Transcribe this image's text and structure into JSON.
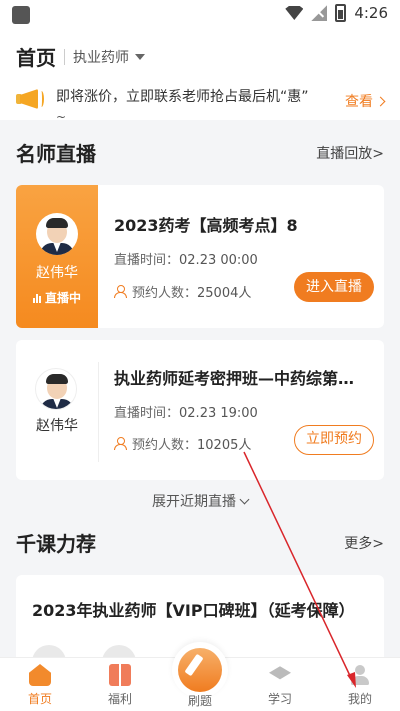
{
  "status_bar": {
    "time": "4:26"
  },
  "header": {
    "title": "首页",
    "subject": "执业药师",
    "notice": "即将涨价，立即联系老师抢占最后机“惠”",
    "notice_tail": "~",
    "notice_link": "查看"
  },
  "live_section": {
    "title": "名师直播",
    "link": "直播回放>",
    "cards": [
      {
        "teacher": "赵伟华",
        "status": "直播中",
        "course": "2023药考【高频考点】8",
        "time_label": "直播时间：",
        "time": "02.23 00:00",
        "count_label": "预约人数：",
        "count": "25004人",
        "button": "进入直播"
      },
      {
        "teacher": "赵伟华",
        "course": "执业药师延考密押班—中药综第…",
        "time_label": "直播时间：",
        "time": "02.23 19:00",
        "count_label": "预约人数：",
        "count": "10205人",
        "button": "立即预约"
      }
    ],
    "expand": "展开近期直播"
  },
  "recommend_section": {
    "title": "千课力荐",
    "link": "更多>",
    "course": "2023年执业药师【VIP口碑班】（延考保障）"
  },
  "tabbar": {
    "tabs": [
      {
        "label": "首页",
        "icon": "home-icon"
      },
      {
        "label": "福利",
        "icon": "gift-icon"
      },
      {
        "label": "刷题",
        "icon": "pen-icon"
      },
      {
        "label": "学习",
        "icon": "graduation-cap-icon"
      },
      {
        "label": "我的",
        "icon": "person-icon"
      }
    ],
    "active": "首页"
  },
  "colors": {
    "accent": "#f07c20",
    "background": "#f4f5f7"
  }
}
